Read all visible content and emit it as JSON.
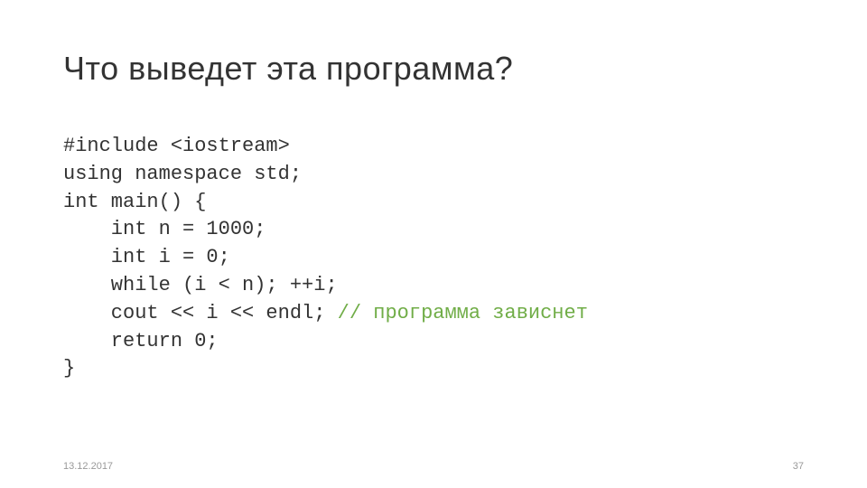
{
  "title": "Что выведет эта программа?",
  "code": {
    "line1": "#include <iostream>",
    "line2": "using namespace std;",
    "line3": "",
    "line4": "int main() {",
    "line5": "    int n = 1000;",
    "line6": "    int i = 0;",
    "line7": "    while (i < n); ++i;",
    "line8_code": "    cout << i << endl; ",
    "line8_comment": "// программа зависнет",
    "line9": "    return 0;",
    "line10": "}"
  },
  "footer": {
    "date": "13.12.2017",
    "page": "37"
  }
}
